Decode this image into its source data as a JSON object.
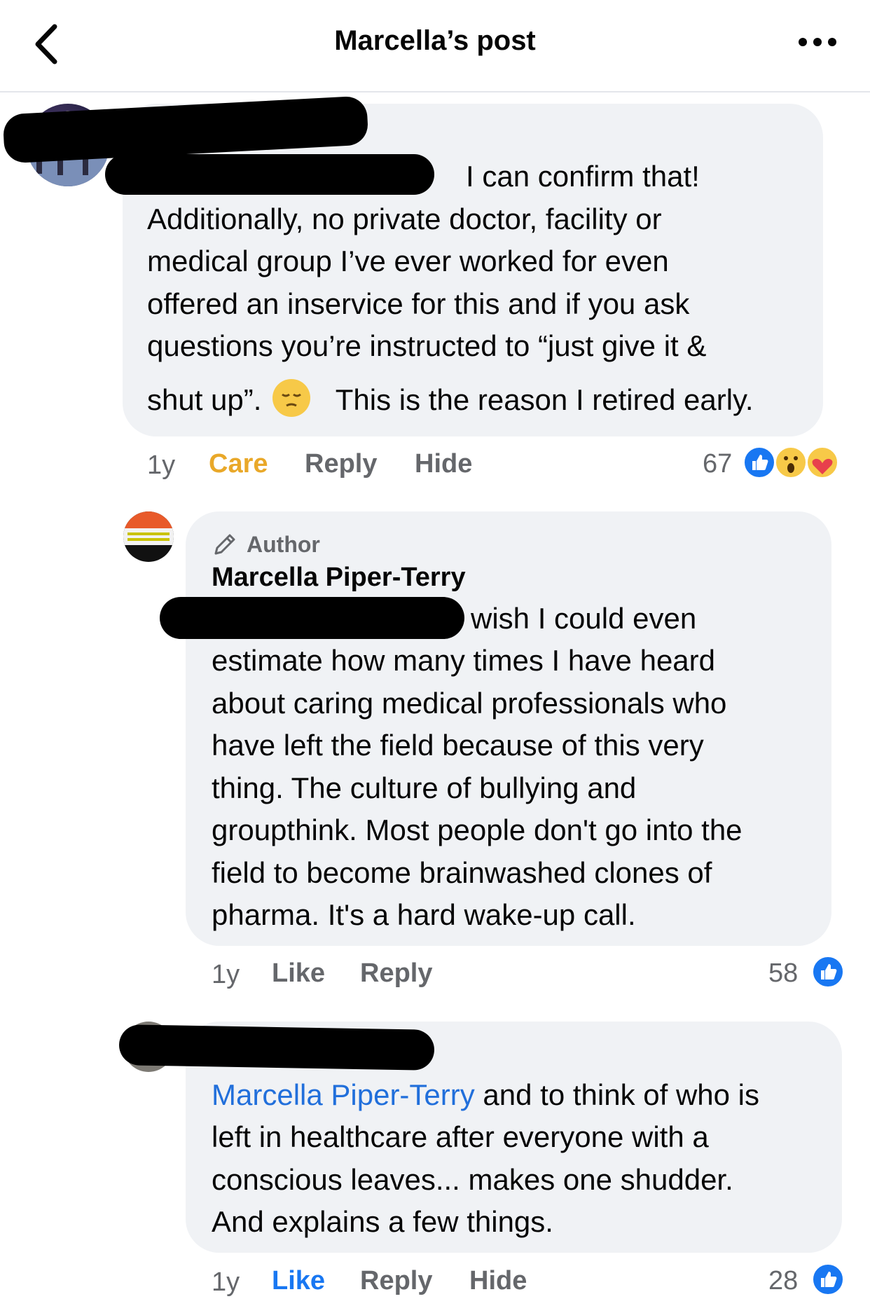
{
  "header": {
    "title": "Marcella’s post"
  },
  "comments": [
    {
      "lines": [
        "I can confirm that!",
        "Additionally, no private doctor, facility or",
        "medical group I’ve ever worked for even",
        "offered an inservice for this and if you ask",
        "questions you’re instructed to “just give it &",
        "shut up”.",
        "This is the reason I retired early."
      ],
      "time": "1y",
      "reaction_label": "Care",
      "reply": "Reply",
      "hide": "Hide",
      "count": "67"
    },
    {
      "author_badge": "Author",
      "author": "Marcella Piper-Terry",
      "lines": [
        "wish I could even",
        "estimate how many times I have heard",
        "about caring medical professionals who",
        "have left the field because of this very",
        "thing. The culture of bullying and",
        "groupthink. Most people don't go into the",
        "field to become brainwashed clones of",
        "pharma. It's a hard wake-up call."
      ],
      "time": "1y",
      "like": "Like",
      "reply": "Reply",
      "count": "58"
    },
    {
      "mention": "Marcella Piper-Terry",
      "lines": [
        "and to think of who is",
        "left in healthcare after everyone with a",
        "conscious leaves... makes one shudder.",
        "And explains a few things."
      ],
      "time": "1y",
      "like": "Like",
      "reply": "Reply",
      "hide": "Hide",
      "count": "28"
    }
  ],
  "colors": {
    "care": "#e9a829",
    "like_active": "#1877f2",
    "mention": "#216fdb",
    "bubble": "#f0f2f5",
    "muted": "#65676b"
  },
  "icons": {
    "back": "chevron-left-icon",
    "more": "more-dots-icon",
    "pencil": "pencil-icon",
    "like": "thumbs-up-icon",
    "wow": "wow-emoji-icon",
    "care": "care-emoji-icon",
    "pensive": "pensive-emoji-icon"
  }
}
